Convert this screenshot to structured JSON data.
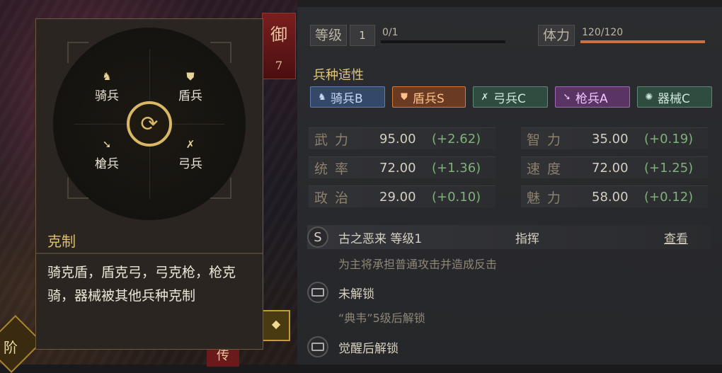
{
  "hero": {
    "defense_char": "御",
    "defense_value": "7",
    "rank_char": "阶",
    "bottom_char": "传"
  },
  "level": {
    "label": "等级",
    "value": "1",
    "exp": "0/1",
    "exp_progress": 0
  },
  "stamina": {
    "label": "体力",
    "value": "120/120",
    "progress": 1.0
  },
  "aptitude": {
    "title": "兵种适性",
    "items": [
      {
        "label": "骑兵B",
        "icon": "horse-icon"
      },
      {
        "label": "盾兵S",
        "icon": "shield-icon"
      },
      {
        "label": "弓兵C",
        "icon": "bow-icon"
      },
      {
        "label": "枪兵A",
        "icon": "spear-icon"
      },
      {
        "label": "器械C",
        "icon": "wheel-icon"
      }
    ]
  },
  "stats": [
    {
      "name": "武力",
      "value": "95.00",
      "bonus": "(+2.62)"
    },
    {
      "name": "智力",
      "value": "35.00",
      "bonus": "(+0.19)"
    },
    {
      "name": "统率",
      "value": "72.00",
      "bonus": "(+1.36)"
    },
    {
      "name": "速度",
      "value": "72.00",
      "bonus": "(+1.25)"
    },
    {
      "name": "政治",
      "value": "29.00",
      "bonus": "(+0.10)"
    },
    {
      "name": "魅力",
      "value": "58.00",
      "bonus": "(+0.12)"
    }
  ],
  "skills": {
    "main": {
      "badge": "S",
      "name": "古之恶来 等级1",
      "type": "指挥",
      "view": "查看",
      "desc": "为主将承担普通攻击并造成反击"
    },
    "slot2": {
      "name": "未解锁",
      "hint": "“典韦”5级后解锁"
    },
    "slot3": {
      "name": "觉醒后解锁"
    }
  },
  "tooltip": {
    "units": {
      "cavalry": "骑兵",
      "shield": "盾兵",
      "spear": "槍兵",
      "bow": "弓兵"
    },
    "title": "克制",
    "body": "骑克盾，盾克弓，弓克枪，枪克骑，器械被其他兵种克制"
  },
  "colors": {
    "accent_gold": "#e0bf6a",
    "bonus_green": "#7fb07a",
    "stamina_orange": "#d1703c"
  }
}
